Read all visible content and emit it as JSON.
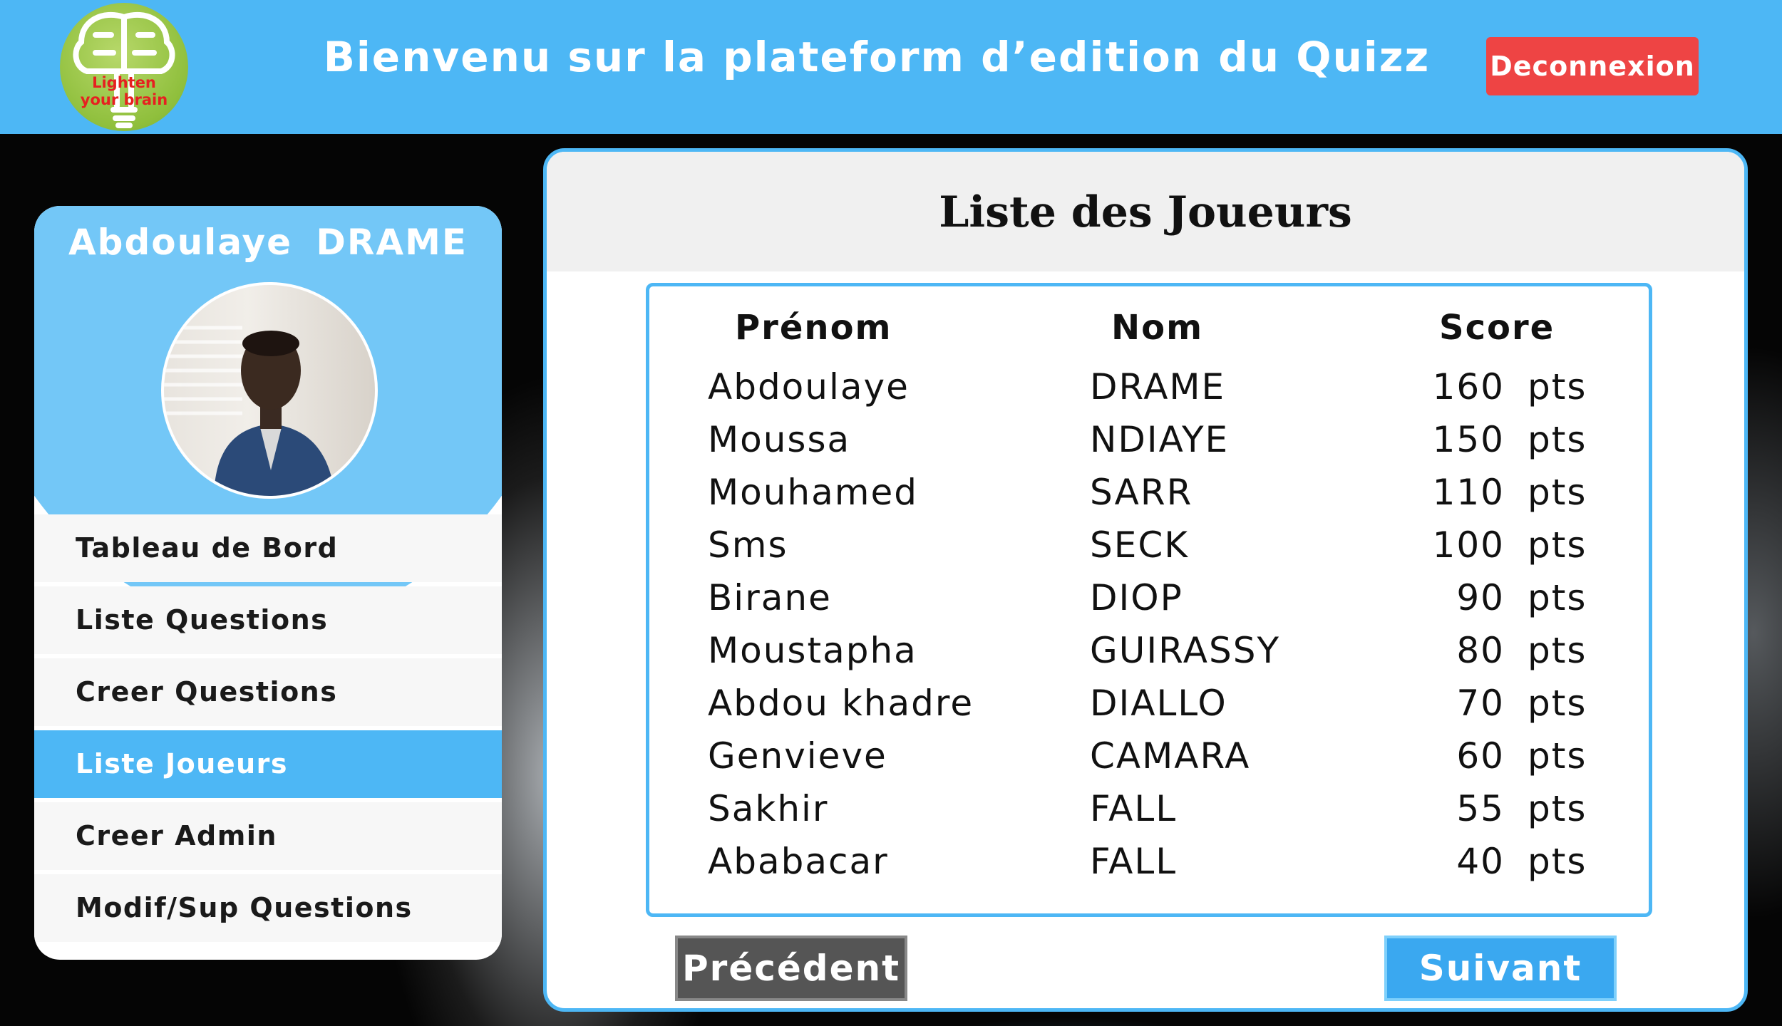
{
  "header": {
    "logo_line1": "Lighten",
    "logo_line2": "your brain",
    "title": "Bienvenu sur la plateform d’edition du Quizz",
    "logout_label": "Deconnexion"
  },
  "sidebar": {
    "user_name": "Abdoulaye  DRAME",
    "items": [
      {
        "label": "Tableau de Bord",
        "active": false
      },
      {
        "label": "Liste Questions",
        "active": false
      },
      {
        "label": "Creer Questions",
        "active": false
      },
      {
        "label": "Liste Joueurs",
        "active": true
      },
      {
        "label": "Creer Admin",
        "active": false
      },
      {
        "label": "Modif/Sup Questions",
        "active": false
      }
    ]
  },
  "main": {
    "title": "Liste des Joueurs",
    "columns": [
      "Prénom",
      "Nom",
      "Score"
    ],
    "rows": [
      {
        "prenom": "Abdoulaye",
        "nom": "DRAME",
        "score": "160",
        "unit": "pts"
      },
      {
        "prenom": "Moussa",
        "nom": "NDIAYE",
        "score": "150",
        "unit": "pts"
      },
      {
        "prenom": "Mouhamed",
        "nom": "SARR",
        "score": "110",
        "unit": "pts"
      },
      {
        "prenom": "Sms",
        "nom": "SECK",
        "score": "100",
        "unit": "pts"
      },
      {
        "prenom": "Birane",
        "nom": "DIOP",
        "score": "90",
        "unit": "pts"
      },
      {
        "prenom": "Moustapha",
        "nom": "GUIRASSY",
        "score": "80",
        "unit": "pts"
      },
      {
        "prenom": "Abdou khadre",
        "nom": "DIALLO",
        "score": "70",
        "unit": "pts"
      },
      {
        "prenom": "Genvieve",
        "nom": "CAMARA",
        "score": "60",
        "unit": "pts"
      },
      {
        "prenom": "Sakhir",
        "nom": "FALL",
        "score": "55",
        "unit": "pts"
      },
      {
        "prenom": "Ababacar",
        "nom": "FALL",
        "score": "40",
        "unit": "pts"
      }
    ],
    "prev_label": "Précédent",
    "next_label": "Suivant"
  },
  "colors": {
    "accent": "#4db7f5",
    "logout": "#ee4444",
    "prev_button": "#555555"
  }
}
